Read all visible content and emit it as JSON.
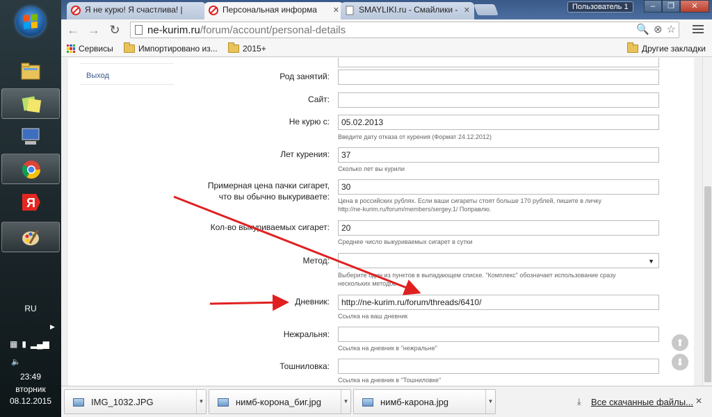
{
  "taskbar": {
    "lang": "RU",
    "time": "23:49",
    "day": "вторник",
    "date": "08.12.2015"
  },
  "browser": {
    "tabs": [
      {
        "title": "Я не курю! Я счастлива! |",
        "active": false
      },
      {
        "title": "Персональная информа",
        "active": true
      },
      {
        "title": "SMAYLIKI.ru - Смайлики -",
        "active": false
      }
    ],
    "profile": "Пользователь 1",
    "url_host": "ne-kurim.ru",
    "url_path": "/forum/account/personal-details",
    "bookmarks": {
      "services": "Сервисы",
      "imported": "Импортировано из...",
      "year": "2015+",
      "other": "Другие закладки"
    }
  },
  "page": {
    "sidebar_link": "Выход",
    "form": {
      "occupation_label": "Род занятий:",
      "occupation_value": "",
      "site_label": "Сайт:",
      "site_value": "",
      "quit_label": "Не курю с:",
      "quit_value": "05.02.2013",
      "quit_hint": "Введите дату отказа от курения (Формат 24.12.2012)",
      "years_label": "Лет курения:",
      "years_value": "37",
      "years_hint": "Сколько лет вы курили",
      "price_label_1": "Примерная цена пачки сигарет,",
      "price_label_2": "что вы обычно выкуриваете:",
      "price_value": "30",
      "price_hint_1": "Цена в российских рублях. Если ваши сигареты стоят больше 170 рублей, пишите в личку",
      "price_hint_2": "http://ne-kurim.ru/forum/members/sergey.1/ Поправлю.",
      "count_label": "Кол-во выкуриваемых сигарет:",
      "count_value": "20",
      "count_hint": "Среднее число выкуриваемых сигарет в сутки",
      "method_label": "Метод:",
      "method_value": "",
      "method_hint_1": "Выберите один из пунктов в выпадающем списке. \"Комплекс\" обозначает использование сразу",
      "method_hint_2": "нескольких методов",
      "diary_label": "Дневник:",
      "diary_value": "http://ne-kurim.ru/forum/threads/6410/",
      "diary_hint": "Ссылка на ваш дневник",
      "nonrelapse_label": "Нежральня:",
      "nonrelapse_value": "",
      "nonrelapse_hint": "Ссылка на дневник в \"нежральне\"",
      "nausea_label": "Тошниловка:",
      "nausea_value": "",
      "nausea_hint": "Ссылка на дневник в \"Тошниловке\""
    }
  },
  "downloads": {
    "items": [
      {
        "name": "IMG_1032.JPG"
      },
      {
        "name": "нимб-корона_биг.jpg"
      },
      {
        "name": "нимб-карона.jpg"
      }
    ],
    "show_all": "Все скачанные файлы..."
  },
  "colors": {
    "annotation_arrow": "#e02020",
    "link": "#3a5a88"
  }
}
